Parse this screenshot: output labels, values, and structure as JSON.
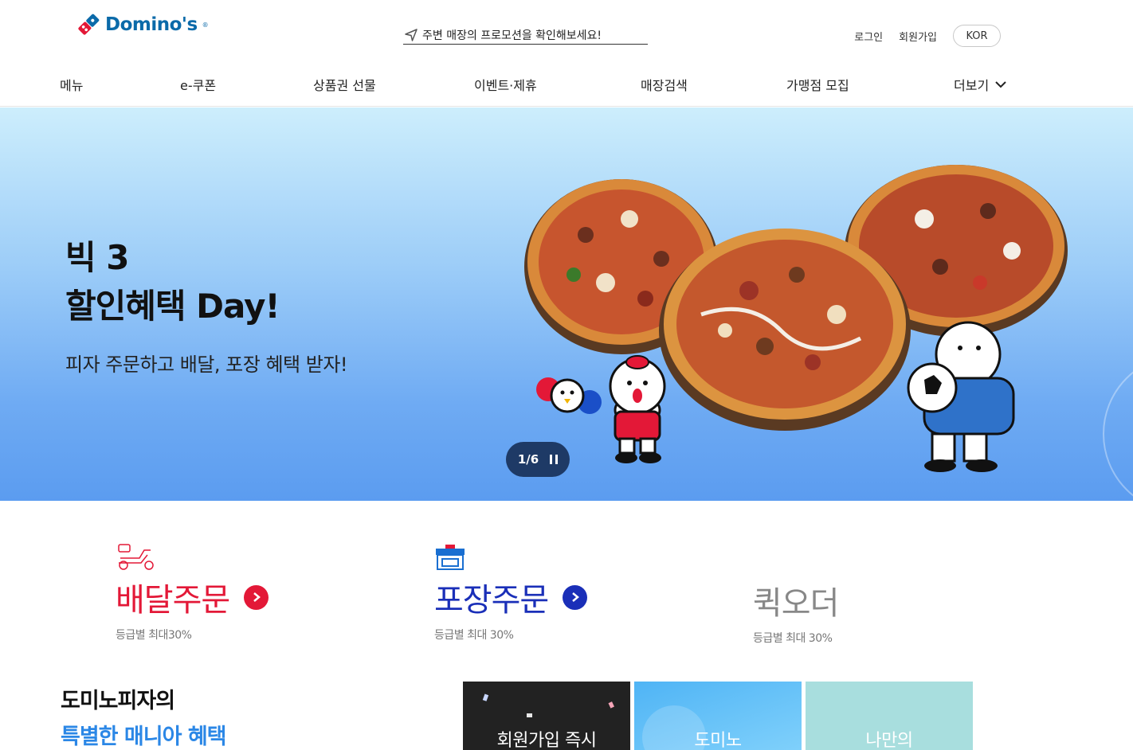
{
  "header": {
    "logo_text": "Domino's",
    "promo_text": "주변 매장의 프로모션을 확인해보세요!",
    "login": "로그인",
    "signup": "회원가입",
    "language": "KOR"
  },
  "nav": {
    "items": [
      "메뉴",
      "e-쿠폰",
      "상품권 선물",
      "이벤트·제휴",
      "매장검색",
      "가맹점 모집",
      "더보기"
    ]
  },
  "hero": {
    "title_line1": "빅 3",
    "title_line2": "할인혜택 Day!",
    "subtitle": "피자 주문하고 배달, 포장 혜택 받자!",
    "pager": "1/6"
  },
  "order": {
    "delivery": {
      "title": "배달주문",
      "sub": "등급별 최대30%",
      "color": "#e31837"
    },
    "pickup": {
      "title": "포장주문",
      "sub": "등급별 최대 30%",
      "color": "#1a2fb8"
    },
    "quick": {
      "title": "퀵오더",
      "sub": "등급별 최대 30%",
      "color": "#888888"
    }
  },
  "benefit": {
    "line1": "도미노피자의",
    "line2": "특별한 매니아 혜택",
    "tiles": [
      "회원가입 즉시",
      "도미노",
      "나만의"
    ]
  },
  "colors": {
    "brand_blue": "#0b6aa9",
    "brand_red": "#e31837",
    "pager_bg": "#1e3a66"
  }
}
